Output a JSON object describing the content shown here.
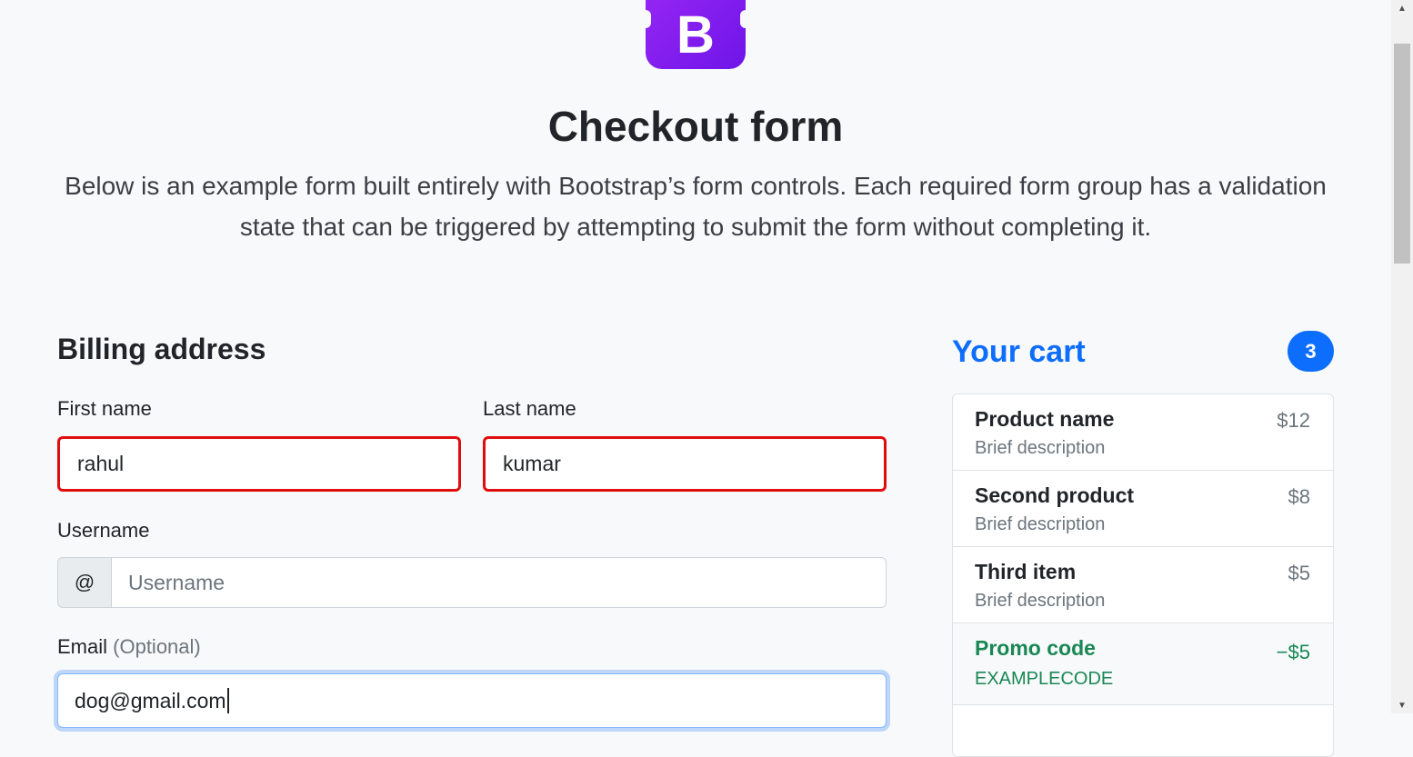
{
  "header": {
    "logo_letter": "B",
    "title": "Checkout form",
    "lead": "Below is an example form built entirely with Bootstrap’s form controls. Each required form group has a validation state that can be triggered by attempting to submit the form without completing it."
  },
  "billing": {
    "heading": "Billing address",
    "first_name": {
      "label": "First name",
      "value": "rahul"
    },
    "last_name": {
      "label": "Last name",
      "value": "kumar"
    },
    "username": {
      "label": "Username",
      "addon": "@",
      "placeholder": "Username"
    },
    "email": {
      "label": "Email",
      "optional": "(Optional)",
      "value": "dog@gmail.com"
    }
  },
  "cart": {
    "heading": "Your cart",
    "count": "3",
    "items": [
      {
        "name": "Product name",
        "desc": "Brief description",
        "price": "$12"
      },
      {
        "name": "Second product",
        "desc": "Brief description",
        "price": "$8"
      },
      {
        "name": "Third item",
        "desc": "Brief description",
        "price": "$5"
      }
    ],
    "promo": {
      "name": "Promo code",
      "code": "EXAMPLECODE",
      "amount": "−$5"
    }
  },
  "colors": {
    "primary": "#0d6efd",
    "success": "#198754",
    "invalid": "#e00d0d",
    "logo": "#7a17f0"
  }
}
